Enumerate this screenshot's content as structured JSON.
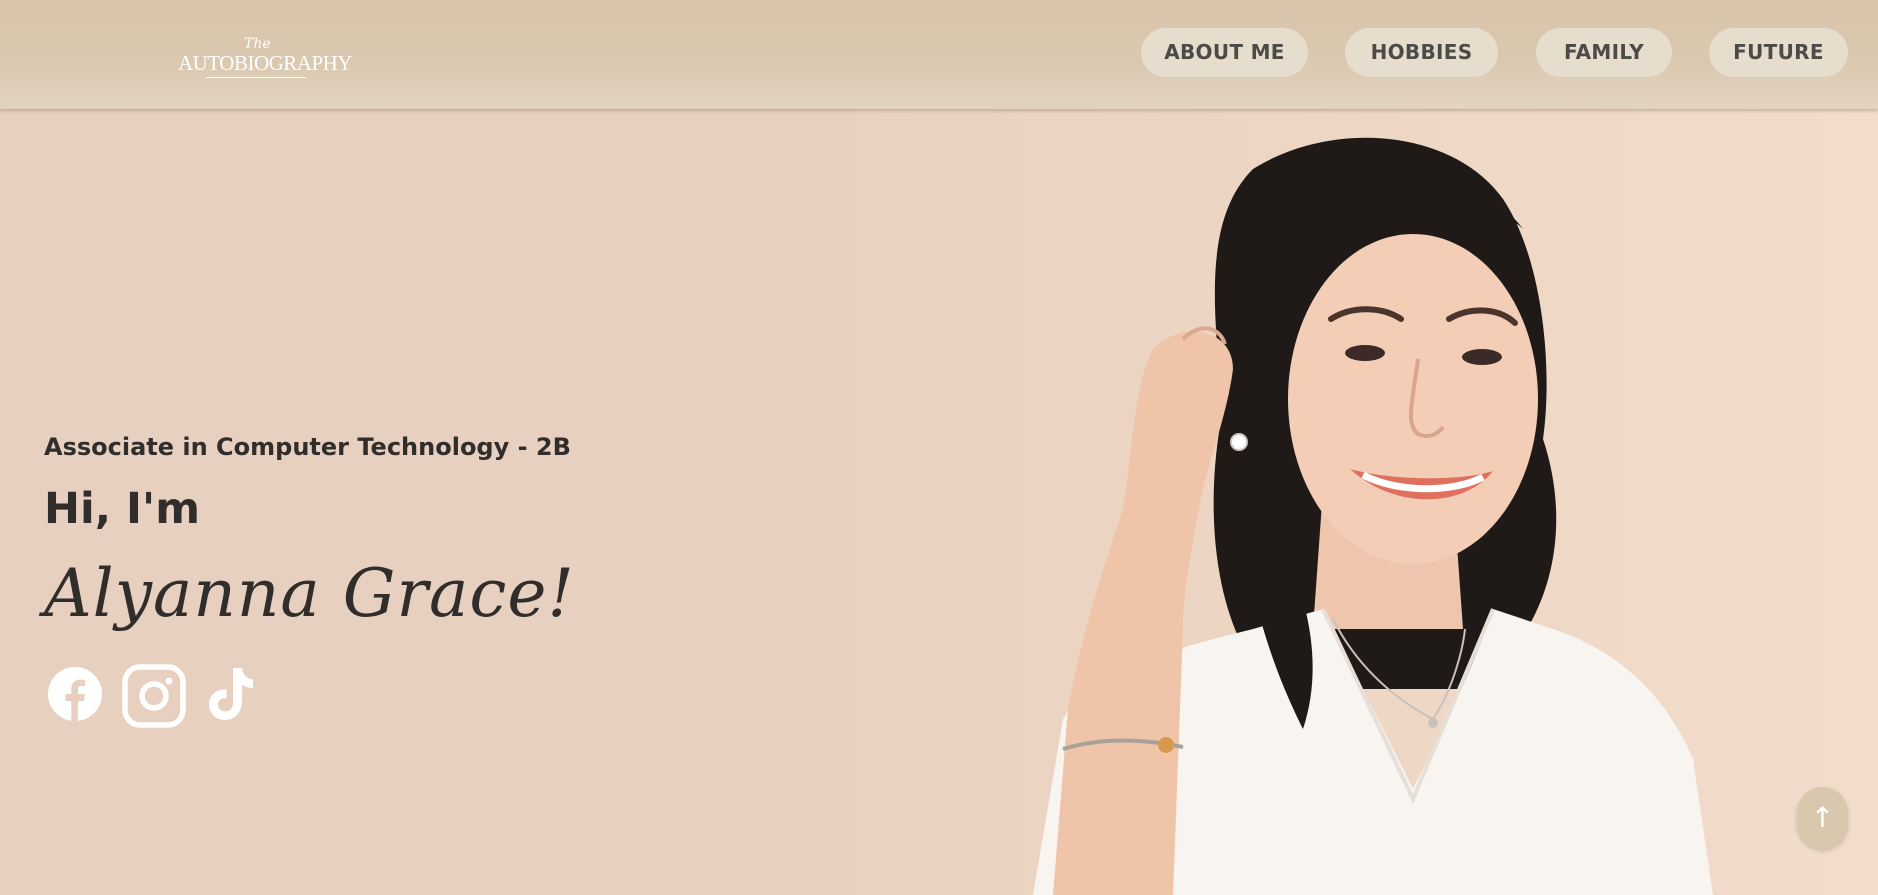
{
  "header": {
    "logo": {
      "script_text": "The",
      "word_text": "AUTOBIOGRAPHY"
    },
    "nav": [
      {
        "label": "ABOUT ME"
      },
      {
        "label": "HOBBIES"
      },
      {
        "label": "FAMILY"
      },
      {
        "label": "FUTURE"
      }
    ]
  },
  "hero": {
    "subtitle": "Associate in Computer Technology - 2B",
    "greeting": "Hi, I'm",
    "name": "Alyanna Grace!",
    "social_icons": [
      "facebook-icon",
      "instagram-icon",
      "tiktok-icon"
    ],
    "photo_alt": "portrait-photo"
  },
  "scroll_top": {
    "icon": "arrow-up-icon",
    "glyph": "↑"
  },
  "colors": {
    "header_bg": "#d8c4aa",
    "page_bg": "#e8d0c1",
    "nav_pill": "#e6ddcc",
    "nav_text": "#4d4b48",
    "text_dark": "#302d2b",
    "scroll_button": "#d9c8ad"
  }
}
